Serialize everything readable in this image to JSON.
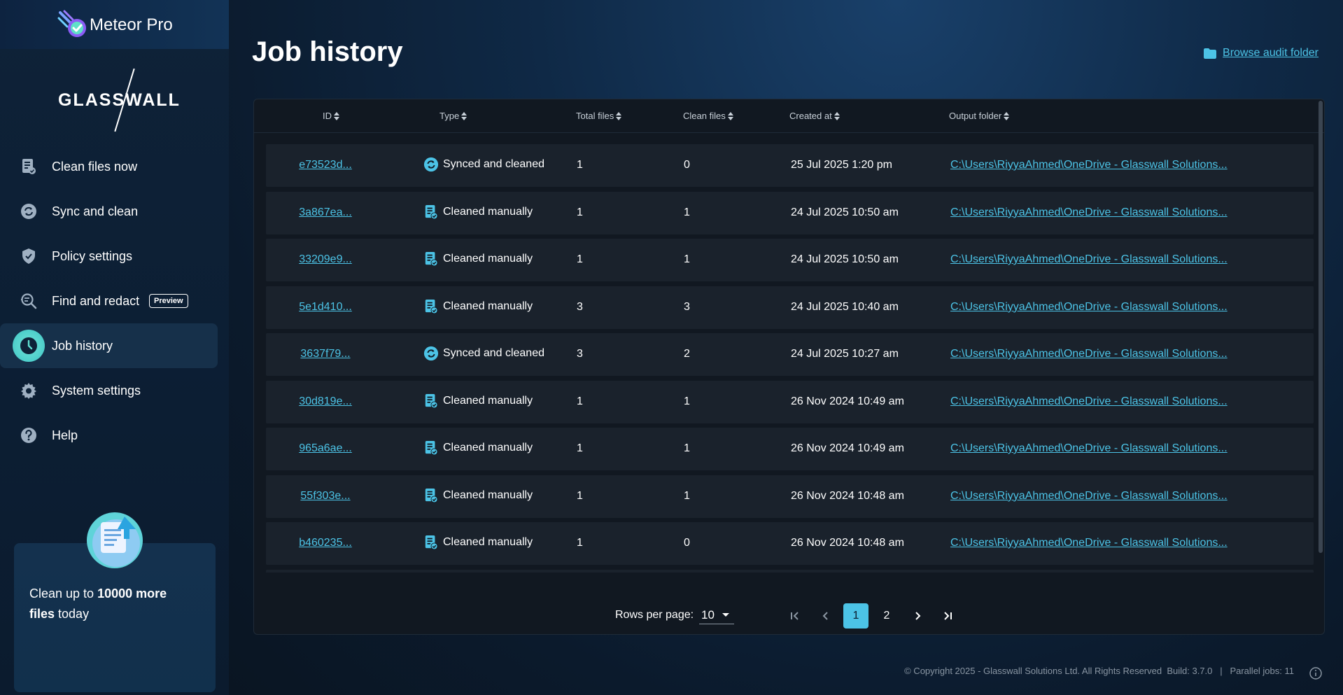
{
  "app": {
    "name": "Meteor Pro",
    "vendor_logo_text": "GLASSWALL"
  },
  "sidebar": {
    "items": [
      {
        "label": "Clean files now",
        "icon": "clean-files-icon"
      },
      {
        "label": "Sync and clean",
        "icon": "sync-icon"
      },
      {
        "label": "Policy settings",
        "icon": "shield-icon"
      },
      {
        "label": "Find and redact",
        "icon": "search-redact-icon",
        "badge": "Preview"
      },
      {
        "label": "Job history",
        "icon": "clock-icon",
        "active": true
      },
      {
        "label": "System settings",
        "icon": "gear-icon"
      },
      {
        "label": "Help",
        "icon": "help-icon"
      }
    ],
    "promo": {
      "prefix": "Clean up to ",
      "bold1": "10000 more",
      "bold2": "files",
      "suffix": " today"
    }
  },
  "main": {
    "title": "Job history",
    "browse_link": "Browse audit folder",
    "columns": [
      "ID",
      "Type",
      "Total files",
      "Clean files",
      "Created at",
      "Output folder"
    ],
    "rows": [
      {
        "id": "e73523d...",
        "type": "Synced and cleaned",
        "type_icon": "sync-icon",
        "total": "1",
        "clean": "0",
        "created": "25 Jul 2025 1:20 pm",
        "folder": "C:\\Users\\RiyyaAhmed\\OneDrive - Glasswall Solutions..."
      },
      {
        "id": "3a867ea...",
        "type": "Cleaned manually",
        "type_icon": "clean-files-icon",
        "total": "1",
        "clean": "1",
        "created": "24 Jul 2025 10:50 am",
        "folder": "C:\\Users\\RiyyaAhmed\\OneDrive - Glasswall Solutions..."
      },
      {
        "id": "33209e9...",
        "type": "Cleaned manually",
        "type_icon": "clean-files-icon",
        "total": "1",
        "clean": "1",
        "created": "24 Jul 2025 10:50 am",
        "folder": "C:\\Users\\RiyyaAhmed\\OneDrive - Glasswall Solutions..."
      },
      {
        "id": "5e1d410...",
        "type": "Cleaned manually",
        "type_icon": "clean-files-icon",
        "total": "3",
        "clean": "3",
        "created": "24 Jul 2025 10:40 am",
        "folder": "C:\\Users\\RiyyaAhmed\\OneDrive - Glasswall Solutions..."
      },
      {
        "id": "3637f79...",
        "type": "Synced and cleaned",
        "type_icon": "sync-icon",
        "total": "3",
        "clean": "2",
        "created": "24 Jul 2025 10:27 am",
        "folder": "C:\\Users\\RiyyaAhmed\\OneDrive - Glasswall Solutions..."
      },
      {
        "id": "30d819e...",
        "type": "Cleaned manually",
        "type_icon": "clean-files-icon",
        "total": "1",
        "clean": "1",
        "created": "26 Nov 2024 10:49 am",
        "folder": "C:\\Users\\RiyyaAhmed\\OneDrive - Glasswall Solutions..."
      },
      {
        "id": "965a6ae...",
        "type": "Cleaned manually",
        "type_icon": "clean-files-icon",
        "total": "1",
        "clean": "1",
        "created": "26 Nov 2024 10:49 am",
        "folder": "C:\\Users\\RiyyaAhmed\\OneDrive - Glasswall Solutions..."
      },
      {
        "id": "55f303e...",
        "type": "Cleaned manually",
        "type_icon": "clean-files-icon",
        "total": "1",
        "clean": "1",
        "created": "26 Nov 2024 10:48 am",
        "folder": "C:\\Users\\RiyyaAhmed\\OneDrive - Glasswall Solutions..."
      },
      {
        "id": "b460235...",
        "type": "Cleaned manually",
        "type_icon": "clean-files-icon",
        "total": "1",
        "clean": "0",
        "created": "26 Nov 2024 10:48 am",
        "folder": "C:\\Users\\RiyyaAhmed\\OneDrive - Glasswall Solutions..."
      },
      {
        "id": "",
        "type": "",
        "type_icon": "sync-icon",
        "total": "",
        "clean": "",
        "created": "",
        "folder": ""
      }
    ],
    "pagination": {
      "rows_per_page_label": "Rows per page:",
      "rows_per_page": "10",
      "pages": [
        "1",
        "2"
      ],
      "current_page": "1"
    }
  },
  "footer": {
    "copyright": "© Copyright 2025 - Glasswall Solutions Ltd. All Rights Reserved",
    "build": "Build: 3.7.0",
    "separator": "|",
    "parallel_jobs": "Parallel jobs: 11"
  },
  "colors": {
    "accent": "#4cc3e6",
    "active_icon": "#3fc5c4",
    "sidebar_bg": "#0e2238",
    "panel_bg": "#111821"
  }
}
